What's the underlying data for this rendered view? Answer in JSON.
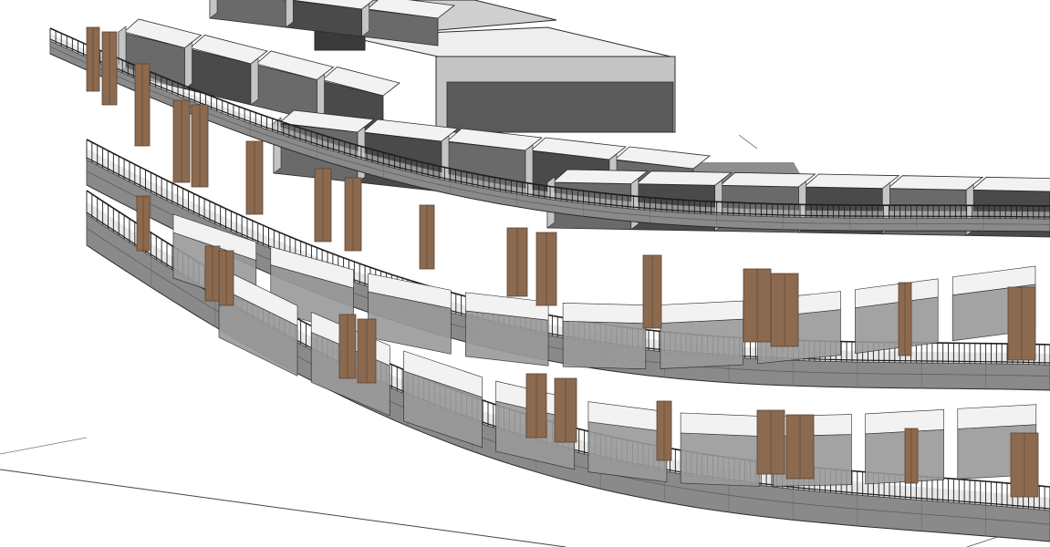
{
  "view": {
    "background": "#ffffff",
    "subject": "curved-building-3d-section"
  },
  "colors": {
    "slab": "#8a8a8a",
    "slab_edge": "#6f6f6f",
    "slab_top": "#b8b8b8",
    "wall_light": "#f2f2f2",
    "wall_mid": "#c4c4c4",
    "wall_dark": "#4a4a4a",
    "floor": "#d6d6d6",
    "glass": "#9a9a9a",
    "timber_panel": "#8b6a4f",
    "timber_dark": "#5c4433",
    "railing": "#1e1e1e",
    "outline": "#2a2a2a",
    "shadow": "#7a7a7a"
  },
  "model": {
    "levels": 3,
    "units_per_level": 14,
    "timber_panels": true,
    "balcony_railings": true
  }
}
